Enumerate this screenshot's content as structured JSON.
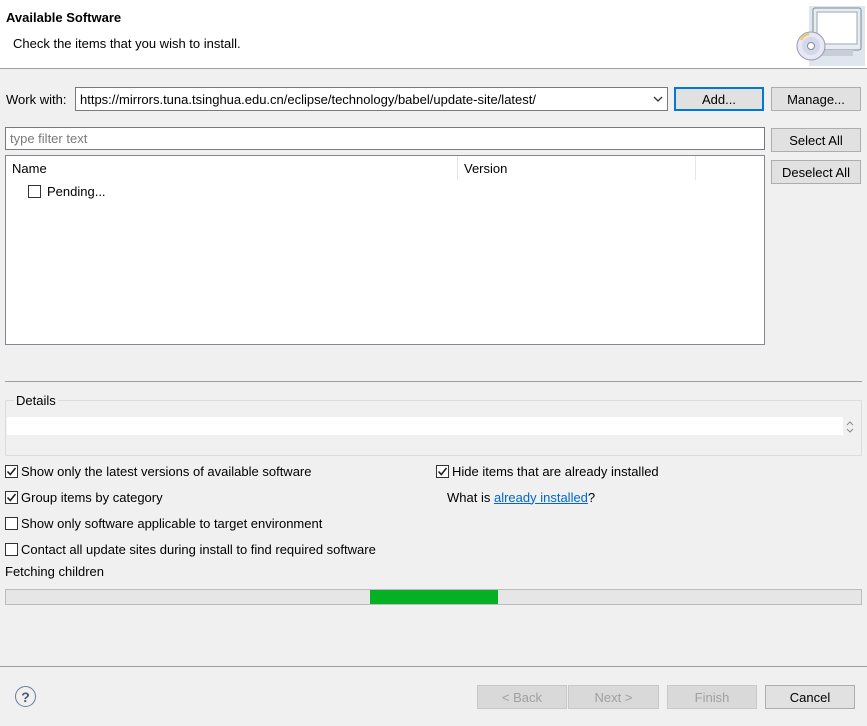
{
  "header": {
    "title": "Available Software",
    "description": "Check the items that you wish to install."
  },
  "work_with": {
    "label": "Work with:",
    "value": "https://mirrors.tuna.tsinghua.edu.cn/eclipse/technology/babel/update-site/latest/",
    "add_label": "Add...",
    "manage_label": "Manage..."
  },
  "filter": {
    "placeholder": "type filter text",
    "value": ""
  },
  "buttons": {
    "select_all": "Select All",
    "deselect_all": "Deselect All"
  },
  "tree": {
    "columns": [
      "Name",
      "Version"
    ],
    "rows": [
      {
        "label": "Pending...",
        "checked": false
      }
    ]
  },
  "details": {
    "title": "Details",
    "text": ""
  },
  "options": {
    "latest_versions": {
      "label": "Show only the latest versions of available software",
      "checked": true
    },
    "group_by_category": {
      "label": "Group items by category",
      "checked": true
    },
    "target_env": {
      "label": "Show only software applicable to target environment",
      "checked": false
    },
    "contact_sites": {
      "label": "Contact all update sites during install to find required software",
      "checked": false
    },
    "hide_installed": {
      "label": "Hide items that are already installed",
      "checked": true
    },
    "what_is_prefix": "What is ",
    "what_is_link": "already installed",
    "what_is_suffix": "?"
  },
  "status": {
    "text": "Fetching children",
    "progress_fraction": 0.15
  },
  "footer": {
    "help_icon": "?",
    "back_label": "< Back",
    "next_label": "Next >",
    "finish_label": "Finish",
    "cancel_label": "Cancel"
  },
  "colors": {
    "progress": "#06b025",
    "link": "#0066cc",
    "accent": "#0078d7"
  },
  "icons": {
    "header": "monitor-cd-icon",
    "combo": "chevron-down-icon",
    "check": "check-icon",
    "help": "help-icon",
    "scroll": "scroll-arrows-icon"
  }
}
